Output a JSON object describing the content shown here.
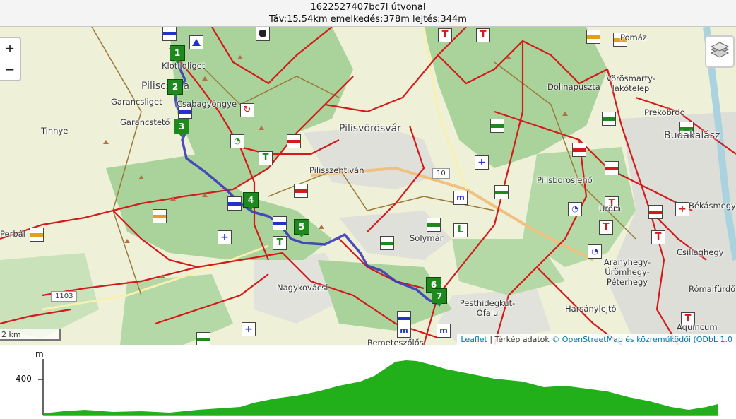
{
  "header": {
    "title": "1622527407bc7l útvonal",
    "stats": "Táv:15.54km emelkedés:378m lejtés:344m"
  },
  "map": {
    "zoom_in": "+",
    "zoom_out": "−",
    "scale_label": "2 km",
    "attribution_leaflet": "Leaflet",
    "attribution_mid": " | Térkép adatok ",
    "attribution_osm": "© OpenStreetMap és közreműködői (ODbL 1.0",
    "places": [
      {
        "id": "kovacsicsliget",
        "text": "Klotildliget"
      },
      {
        "id": "piliscsaba",
        "text": "Piliscsaba"
      },
      {
        "id": "garancsliget",
        "text": "Garancsliget"
      },
      {
        "id": "csabagyongye",
        "text": "Csabagyöngye"
      },
      {
        "id": "garancsteto",
        "text": "Garancstető"
      },
      {
        "id": "tinnye",
        "text": "Tinnye"
      },
      {
        "id": "pilisvorosvar",
        "text": "Pilisvörösvár"
      },
      {
        "id": "pilisszentivan",
        "text": "Pilisszentiván"
      },
      {
        "id": "perbal",
        "text": "Perbál"
      },
      {
        "id": "solymar",
        "text": "Solymár"
      },
      {
        "id": "nagykovacsi",
        "text": "Nagykovácsi"
      },
      {
        "id": "remete",
        "text": "Remeteszőlős"
      },
      {
        "id": "pesthidegkut",
        "text": "Pesthidegkút-Ófalu"
      },
      {
        "id": "harsanylejto",
        "text": "Harsánylejtő"
      },
      {
        "id": "dolinapuszta",
        "text": "Dolinapuszta"
      },
      {
        "id": "vorosmarty",
        "text": "Vörösmarty-lakótelep"
      },
      {
        "id": "prekobrdo",
        "text": "Prekobrdo"
      },
      {
        "id": "budakalasz",
        "text": "Budakalász"
      },
      {
        "id": "pilisborosjeno",
        "text": "Pilisborosjenő"
      },
      {
        "id": "uroM",
        "text": "Üröm"
      },
      {
        "id": "bekasmegyer",
        "text": "Békásmegyer"
      },
      {
        "id": "csillaghegy",
        "text": "Csillaghegy"
      },
      {
        "id": "aranyhegy",
        "text": "Aranyhegy-Ürömhegy-Péterhegy"
      },
      {
        "id": "romaifurdo",
        "text": "Rómaifürdő"
      },
      {
        "id": "aquincum",
        "text": "Aquincum"
      },
      {
        "id": "pomaz",
        "text": "Pomáz"
      }
    ],
    "roads": [
      "10",
      "1103"
    ],
    "markers": [
      "1",
      "2",
      "3",
      "4",
      "5",
      "6",
      "7"
    ]
  },
  "profile": {
    "unit": "m",
    "tick_400": "400"
  },
  "colors": {
    "route": "#3a3ab8",
    "trail": "#d41a1a",
    "forest": "#a9d39b",
    "land": "#eef0d8",
    "profile_fill": "#22b01a",
    "marker": "#1e8a1e"
  }
}
